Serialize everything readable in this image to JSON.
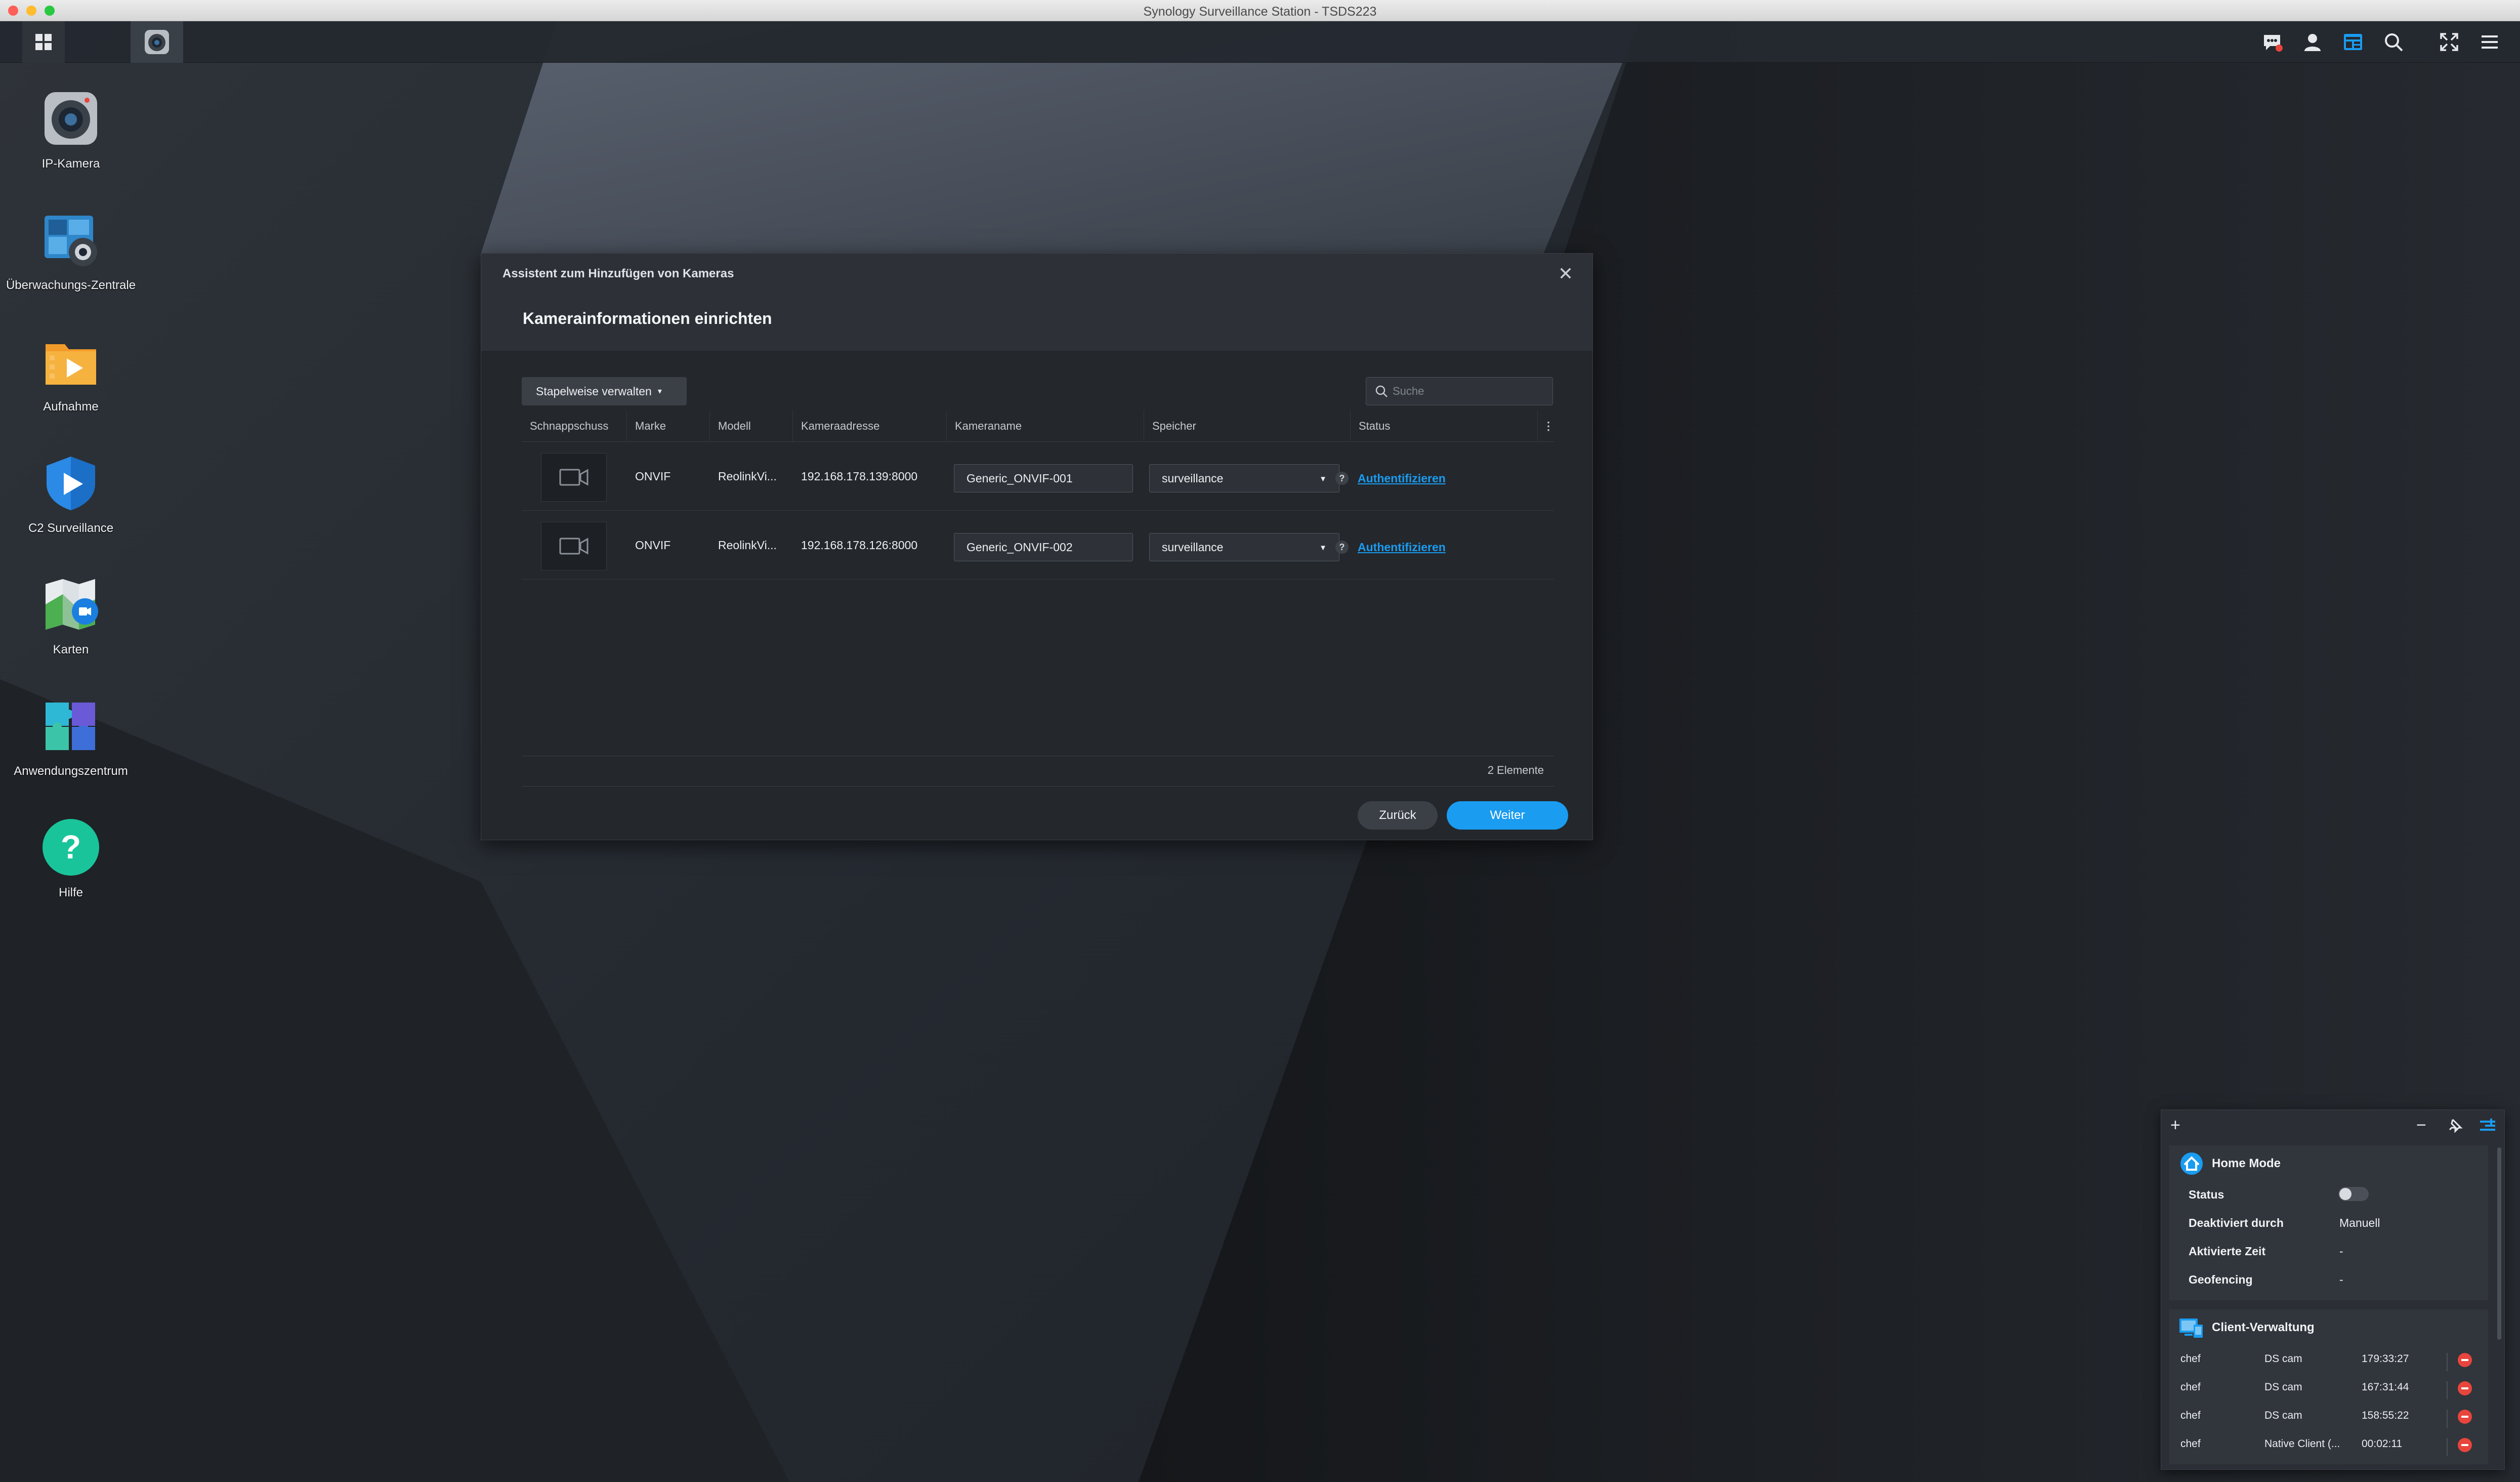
{
  "window": {
    "title": "Synology Surveillance Station - TSDS223"
  },
  "taskbar": {
    "left": [
      "app-grid-icon",
      "camera-app-icon"
    ],
    "right": [
      "notification-icon",
      "user-icon",
      "widgets-icon",
      "search-icon",
      "fullscreen-icon",
      "menu-icon"
    ],
    "notification_color": "#e8453c",
    "active_color": "#1a9cf0"
  },
  "desktop": {
    "icons": [
      {
        "label": "IP-Kamera",
        "icon": "ip-camera-icon"
      },
      {
        "label": "Überwachungs-Zentrale",
        "icon": "monitor-center-icon"
      },
      {
        "label": "Aufnahme",
        "icon": "recording-icon"
      },
      {
        "label": "C2 Surveillance",
        "icon": "c2-shield-icon"
      },
      {
        "label": "Karten",
        "icon": "map-icon"
      },
      {
        "label": "Anwendungszentrum",
        "icon": "app-center-icon"
      },
      {
        "label": "Hilfe",
        "icon": "help-icon"
      }
    ]
  },
  "dialog": {
    "wizard_title": "Assistent zum Hinzufügen von Kameras",
    "step_title": "Kamerainformationen einrichten",
    "batch_button": "Stapelweise verwalten",
    "search_placeholder": "Suche",
    "columns": [
      "Schnappschuss",
      "Marke",
      "Modell",
      "Kameraadresse",
      "Kameraname",
      "Speicher",
      "Status"
    ],
    "rows": [
      {
        "brand": "ONVIF",
        "model": "ReolinkVi...",
        "address": "192.168.178.139:8000",
        "name": "Generic_ONVIF-001",
        "storage": "surveillance",
        "status": "Authentifizieren"
      },
      {
        "brand": "ONVIF",
        "model": "ReolinkVi...",
        "address": "192.168.178.126:8000",
        "name": "Generic_ONVIF-002",
        "storage": "surveillance",
        "status": "Authentifizieren"
      }
    ],
    "item_count": "2 Elemente",
    "back_button": "Zurück",
    "next_button": "Weiter",
    "accent": "#1a9cf0"
  },
  "widget": {
    "home_mode": {
      "title": "Home Mode",
      "status_label": "Status",
      "status_on": false,
      "deactivated_by_label": "Deaktiviert durch",
      "deactivated_by_value": "Manuell",
      "activated_time_label": "Aktivierte Zeit",
      "activated_time_value": "-",
      "geofencing_label": "Geofencing",
      "geofencing_value": "-"
    },
    "client_management": {
      "title": "Client-Verwaltung",
      "clients": [
        {
          "user": "chef",
          "client": "DS cam",
          "duration": "179:33:27"
        },
        {
          "user": "chef",
          "client": "DS cam",
          "duration": "167:31:44"
        },
        {
          "user": "chef",
          "client": "DS cam",
          "duration": "158:55:22"
        },
        {
          "user": "chef",
          "client": "Native Client (...",
          "duration": "00:02:11"
        }
      ]
    }
  }
}
